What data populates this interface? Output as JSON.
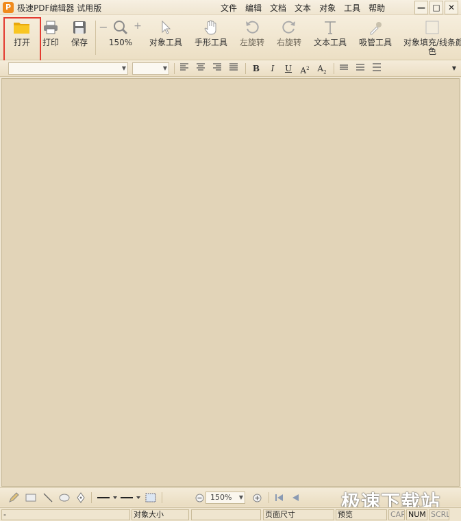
{
  "window": {
    "app_icon": "P",
    "title": "极速PDF编辑器 试用版",
    "minimize": "—",
    "maximize": "□",
    "close": "✕"
  },
  "menu": [
    "文件",
    "编辑",
    "文档",
    "文本",
    "对象",
    "工具",
    "帮助"
  ],
  "toolbar": {
    "open": "打开",
    "print": "打印",
    "save": "保存",
    "zoom_value": "150%",
    "zoom_minus": "−",
    "zoom_plus": "+",
    "object_tool": "对象工具",
    "hand_tool": "手形工具",
    "rotate_left": "左旋转",
    "rotate_right": "右旋转",
    "text_tool": "文本工具",
    "eyedropper": "吸管工具",
    "fill_color": "对象填充/线条颜色",
    "fill_color_line2": "色"
  },
  "format": {
    "font_value": "",
    "size_value": "",
    "bold": "B",
    "italic": "I",
    "underline": "U",
    "superscript": "A",
    "superscript_mark": "2",
    "subscript": "A",
    "subscript_mark": "2"
  },
  "drawbar": {
    "zoom_value": "150%"
  },
  "statusbar": {
    "pane0": "-",
    "object_size": "对象大小",
    "page_size": "页面尺寸",
    "preview": "预览",
    "cap": "CAP",
    "num": "NUM",
    "scrl": "SCRL"
  },
  "watermark": "极速下载站",
  "colors": {
    "accent_highlight": "#e33a2f",
    "open_folder": "#f5b814",
    "canvas": "#e2d4b8"
  },
  "icons": {
    "open": "folder-icon",
    "print": "printer-icon",
    "save": "floppy-icon",
    "zoom": "magnifier-icon",
    "object": "arrow-cursor-icon",
    "hand": "hand-icon",
    "rotate_left": "rotate-left-icon",
    "rotate_right": "rotate-right-icon",
    "text": "text-t-icon",
    "eyedropper": "eyedropper-icon",
    "fill": "color-swatch-icon"
  }
}
